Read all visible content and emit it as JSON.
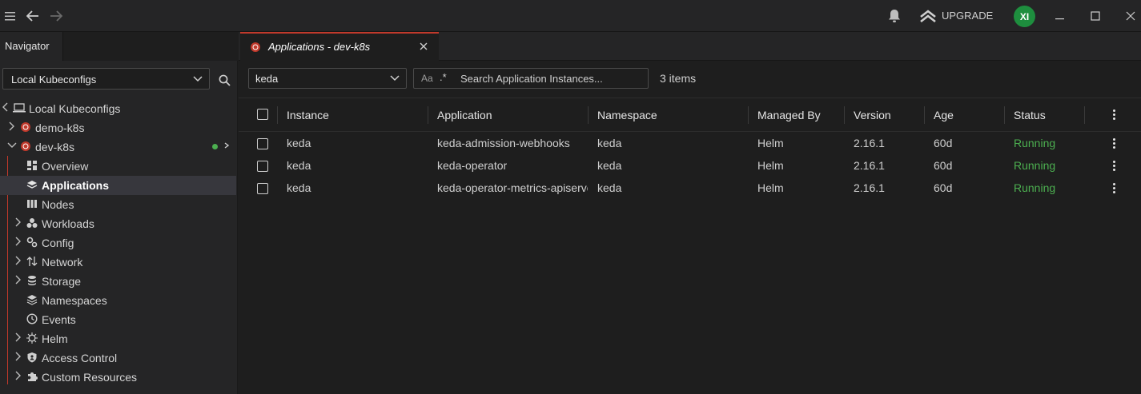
{
  "titlebar": {
    "upgrade_label": "UPGRADE",
    "avatar_initials": "XI"
  },
  "navigator": {
    "tab_label": "Navigator",
    "context_select": "Local Kubeconfigs",
    "tree": {
      "root": "Local Kubeconfigs",
      "clusters": [
        {
          "name": "demo-k8s"
        },
        {
          "name": "dev-k8s"
        }
      ],
      "items": [
        {
          "label": "Overview"
        },
        {
          "label": "Applications"
        },
        {
          "label": "Nodes"
        },
        {
          "label": "Workloads"
        },
        {
          "label": "Config"
        },
        {
          "label": "Network"
        },
        {
          "label": "Storage"
        },
        {
          "label": "Namespaces"
        },
        {
          "label": "Events"
        },
        {
          "label": "Helm"
        },
        {
          "label": "Access Control"
        },
        {
          "label": "Custom Resources"
        }
      ]
    }
  },
  "editor": {
    "tab_title": "Applications - dev-k8s",
    "namespace_select": "keda",
    "search_placeholder": "Search Application Instances...",
    "search_case_label": "Aa",
    "search_regex_label": ".*",
    "item_count": "3 items",
    "columns": [
      "Instance",
      "Application",
      "Namespace",
      "Managed By",
      "Version",
      "Age",
      "Status"
    ],
    "rows": [
      {
        "instance": "keda",
        "application": "keda-admission-webhooks",
        "namespace": "keda",
        "managed_by": "Helm",
        "version": "2.16.1",
        "age": "60d",
        "status": "Running"
      },
      {
        "instance": "keda",
        "application": "keda-operator",
        "namespace": "keda",
        "managed_by": "Helm",
        "version": "2.16.1",
        "age": "60d",
        "status": "Running"
      },
      {
        "instance": "keda",
        "application": "keda-operator-metrics-apiserver",
        "namespace": "keda",
        "managed_by": "Helm",
        "version": "2.16.1",
        "age": "60d",
        "status": "Running"
      }
    ]
  },
  "colors": {
    "accent": "#c0392b",
    "status_running": "#4caf50",
    "avatar_bg": "#1e8e3e",
    "connected_dot": "#4caf50"
  },
  "icons": [
    "hamburger-icon",
    "back-arrow-icon",
    "forward-arrow-icon",
    "bell-icon",
    "upgrade-chevrons-icon",
    "minimize-icon",
    "maximize-icon",
    "close-icon",
    "search-icon",
    "laptop-icon",
    "kubernetes-icon",
    "chevron-right-icon",
    "chevron-down-icon",
    "kebab-icon"
  ]
}
